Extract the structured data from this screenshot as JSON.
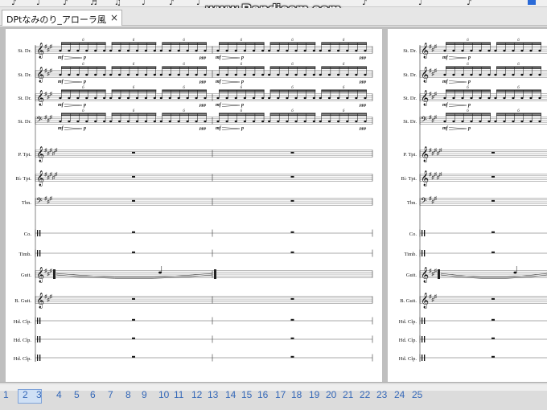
{
  "watermark": "www.Bandicam.com",
  "tab": {
    "title": "DPtなみのり_アローラ風(？)*",
    "close_glyph": "×"
  },
  "instruments": [
    {
      "label": "St. Dr.",
      "clef": "treble",
      "key": "3#",
      "kind": "perc"
    },
    {
      "label": "St. Dr.",
      "clef": "treble",
      "key": "3#",
      "kind": "perc"
    },
    {
      "label": "St. Dr.",
      "clef": "treble",
      "key": "3#",
      "kind": "perc"
    },
    {
      "label": "St. Dr.",
      "clef": "bass",
      "key": "3#",
      "kind": "perc2"
    },
    {
      "label": "P. Tpt.",
      "clef": "treble",
      "key": "5#",
      "kind": "rest"
    },
    {
      "label": "B♭ Tpt.",
      "clef": "treble",
      "key": "5#",
      "kind": "rest"
    },
    {
      "label": "Tbn.",
      "clef": "bass",
      "key": "3#",
      "kind": "rest"
    },
    {
      "label": "Co.",
      "clef": "perc",
      "key": "",
      "kind": "rest"
    },
    {
      "label": "Timb.",
      "clef": "perc",
      "key": "",
      "kind": "rest"
    },
    {
      "label": "Guit.",
      "clef": "treble",
      "key": "3#",
      "kind": "guitar"
    },
    {
      "label": "B. Guit.",
      "clef": "treble",
      "key": "3#",
      "kind": "rest"
    },
    {
      "label": "Hd. Clp.",
      "clef": "perc",
      "key": "",
      "kind": "rest"
    },
    {
      "label": "Hd. Clp.",
      "clef": "perc",
      "key": "",
      "kind": "rest"
    },
    {
      "label": "Hd. Clp.",
      "clef": "perc",
      "key": "",
      "kind": "rest"
    }
  ],
  "dynamics": {
    "start": "mf",
    "mid": "p",
    "end": "ppp",
    "tuplet": "6"
  },
  "measure_numbers": [
    "1",
    "2",
    "3",
    "4",
    "5",
    "6",
    "7",
    "8",
    "9",
    "10",
    "11",
    "12",
    "13",
    "14",
    "15",
    "16",
    "17",
    "18",
    "19",
    "20",
    "21",
    "22",
    "23",
    "24",
    "25"
  ],
  "selected_measure": "2"
}
